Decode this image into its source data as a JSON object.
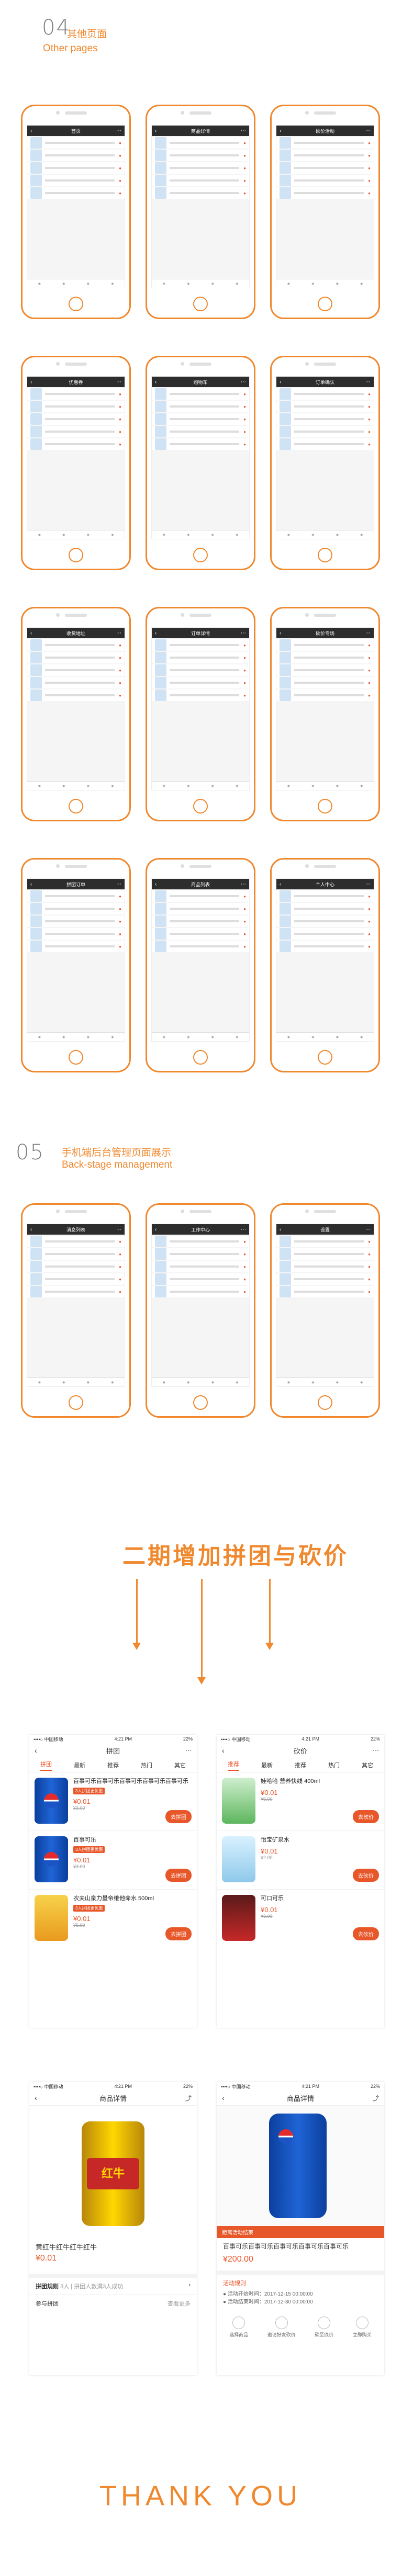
{
  "section04": {
    "num": "04",
    "cn": "其他页面",
    "en": "Other pages"
  },
  "section05": {
    "num": "05",
    "cn": "手机端后台管理页面展示",
    "en": "Back-stage management"
  },
  "phase2_title": "二期增加拼团与砍价",
  "thanks": "THANK   YOU",
  "colors": {
    "accent": "#f0882e",
    "price": "#e8572a"
  },
  "mock_screens": [
    {
      "title": "首页"
    },
    {
      "title": "商品详情"
    },
    {
      "title": "砍价活动"
    },
    {
      "title": "优惠券"
    },
    {
      "title": "购物车"
    },
    {
      "title": "订单确认"
    },
    {
      "title": "收货地址"
    },
    {
      "title": "订单详情"
    },
    {
      "title": "砍价专场"
    },
    {
      "title": "拼团订单"
    },
    {
      "title": "商品列表"
    },
    {
      "title": "个人中心"
    },
    {
      "title": "消息列表"
    },
    {
      "title": "工作中心"
    },
    {
      "title": "设置"
    }
  ],
  "p2_status": {
    "carrier": "••••○ 中国移动",
    "time": "4:21 PM",
    "battery": "22%"
  },
  "group": {
    "nav": "拼团",
    "tabs": [
      "拼团",
      "最新",
      "推荐",
      "热门",
      "其它"
    ],
    "items": [
      {
        "title": "百事可乐百事可乐百事可乐百事可乐百事可乐",
        "price": "¥0.01",
        "old": "¥3.00",
        "tag": "3人拼团更优惠",
        "btn": "去拼团"
      },
      {
        "title": "百事可乐",
        "price": "¥0.01",
        "old": "¥3.00",
        "tag": "3人拼团更优惠",
        "btn": "去拼团"
      },
      {
        "title": "农夫山泉力量帝维他命水 500ml",
        "price": "¥0.01",
        "old": "¥5.00",
        "tag": "3人拼团更优惠",
        "btn": "去拼团"
      }
    ]
  },
  "bargain": {
    "nav": "砍价",
    "tabs": [
      "推荐",
      "最新",
      "推荐",
      "热门",
      "其它"
    ],
    "items": [
      {
        "title": "娃哈哈 营养快线 400ml",
        "price": "¥0.01",
        "old": "¥5.00",
        "btn": "去砍价"
      },
      {
        "title": "怡宝矿泉水",
        "price": "¥0.01",
        "old": "¥2.00",
        "btn": "去砍价"
      },
      {
        "title": "可口可乐",
        "price": "¥0.01",
        "old": "¥3.00",
        "btn": "去砍价"
      }
    ]
  },
  "detail1": {
    "nav": "商品详情",
    "title": "黄红牛红牛红牛红牛",
    "price": "¥0.01",
    "rule": "拼团规则",
    "rule_text": "3人 | 拼团人数满3人成功",
    "join": "参与拼团",
    "more": "查看更多"
  },
  "detail2": {
    "nav": "商品详情",
    "banner": "距离活动结束",
    "title": "百事可乐百事可乐百事可乐百事可乐百事可乐",
    "price": "¥200.00",
    "rule_title": "活动规则",
    "rule1": "● 活动开始时间：2017-12-15 00:00:00",
    "rule2": "● 活动结束时间：2017-12-30 00:00:00",
    "steps": [
      "选择商品",
      "邀请好友砍价",
      "砍至底价",
      "立即购买"
    ]
  }
}
